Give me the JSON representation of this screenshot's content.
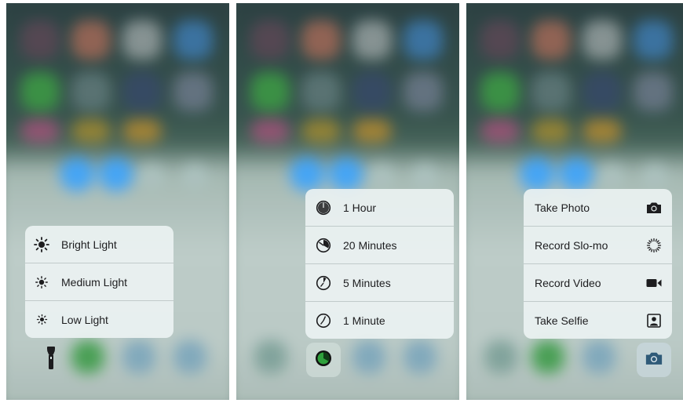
{
  "panels": {
    "flashlight": {
      "menu": [
        {
          "label": "Bright Light",
          "icon": "sun-bright-icon"
        },
        {
          "label": "Medium Light",
          "icon": "sun-medium-icon"
        },
        {
          "label": "Low Light",
          "icon": "sun-low-icon"
        }
      ],
      "button_icon": "flashlight-icon"
    },
    "timer": {
      "menu": [
        {
          "label": "1 Hour",
          "icon": "clock-1-hour-icon"
        },
        {
          "label": "20 Minutes",
          "icon": "clock-20-minutes-icon"
        },
        {
          "label": "5 Minutes",
          "icon": "clock-5-minutes-icon"
        },
        {
          "label": "1 Minute",
          "icon": "clock-1-minute-icon"
        }
      ],
      "button_icon": "timer-icon"
    },
    "camera": {
      "menu": [
        {
          "label": "Take Photo",
          "icon": "camera-icon"
        },
        {
          "label": "Record Slo-mo",
          "icon": "slomo-icon"
        },
        {
          "label": "Record Video",
          "icon": "video-camera-icon"
        },
        {
          "label": "Take Selfie",
          "icon": "selfie-icon"
        }
      ],
      "button_icon": "camera-icon"
    }
  },
  "colors": {
    "menu_bg": "#ecf3f3",
    "accent_blue": "#3aa0f5",
    "timer_green": "#2fa13c"
  }
}
